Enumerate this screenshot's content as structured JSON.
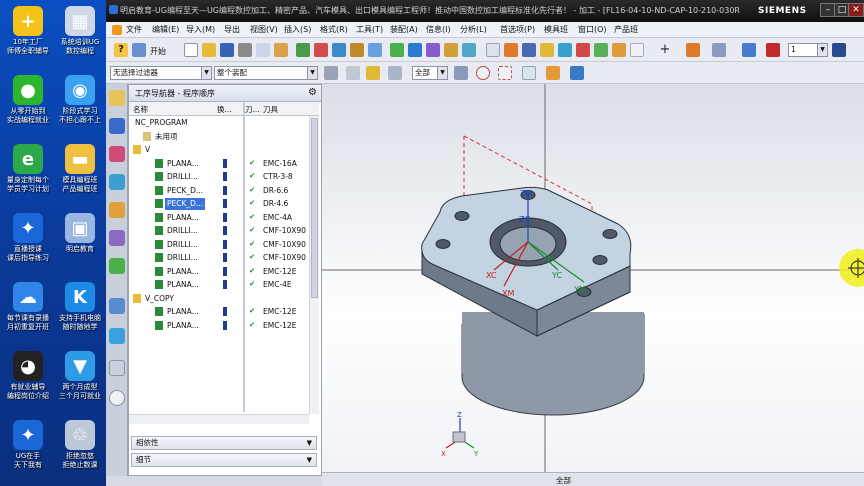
{
  "desktop": {
    "icons": [
      {
        "label1": "10年工厂",
        "label2": "师傅全职辅导",
        "icon": "plus-icon",
        "color": "#f4c21a",
        "glyph": "+"
      },
      {
        "label1": "系统培训UG",
        "label2": "数控编程",
        "icon": "calculator-icon",
        "color": "#cfd8e8",
        "glyph": "▦"
      },
      {
        "label1": "从零开始到",
        "label2": "实战编程就业",
        "icon": "wechat-icon",
        "color": "#2db52d",
        "glyph": "●"
      },
      {
        "label1": "阶段式学习",
        "label2": "不担心跟不上",
        "icon": "globe-icon",
        "color": "#3aa0f0",
        "glyph": "◉"
      },
      {
        "label1": "量身定制每个",
        "label2": "学员学习计划",
        "icon": "ie-icon",
        "color": "#2aa84a",
        "glyph": "e"
      },
      {
        "label1": "模具编程班",
        "label2": "产品编程班",
        "icon": "folder-icon",
        "color": "#f0c040",
        "glyph": "▬"
      },
      {
        "label1": "直播授课",
        "label2": "课后指导练习",
        "icon": "ug-icon",
        "color": "#1a67d8",
        "glyph": "✦"
      },
      {
        "label1": "明启教育",
        "label2": "",
        "icon": "computer-icon",
        "color": "#9ab6e0",
        "glyph": "▣"
      },
      {
        "label1": "每节课有录播",
        "label2": "月初重复开班",
        "icon": "cloud-icon",
        "color": "#2f86e8",
        "glyph": "☁"
      },
      {
        "label1": "支持手机电脑",
        "label2": "随时随地学",
        "icon": "k-icon",
        "color": "#1c8be8",
        "glyph": "K"
      },
      {
        "label1": "有就业辅导",
        "label2": "编程岗位介绍",
        "icon": "qq-icon",
        "color": "#222222",
        "glyph": "◕"
      },
      {
        "label1": "两个月成型",
        "label2": "三个月可就业",
        "icon": "download-icon",
        "color": "#2f9ae8",
        "glyph": "▼"
      },
      {
        "label1": "UG在手",
        "label2": "天下我有",
        "icon": "ug-icon",
        "color": "#1a67d8",
        "glyph": "✦"
      },
      {
        "label1": "拒绝忽悠",
        "label2": "拒绝止数课",
        "icon": "recycle-bin-icon",
        "color": "#bcc8d8",
        "glyph": "♲"
      }
    ]
  },
  "window": {
    "title": "明启教育-UG编程至天—UG编程数控加工、精密产品、汽车模具、出口模具编程工程师！推动中国数控加工编程标准化先行者！ - 加工 - [FL16-04-10-ND-CAP-10-210-030R-...",
    "brand": "SIEMENS",
    "btn_min": "–",
    "btn_max": "□",
    "btn_close": "✕"
  },
  "menubar": {
    "items": [
      "文件",
      "编辑(E)",
      "视图(V)",
      "插入(S)",
      "格式(R)",
      "工具(T)",
      "装配(A)",
      "信息(I)",
      "分析(L)",
      "首选项(P)",
      "模具班",
      "窗口(O)",
      "产品班"
    ],
    "extra": [
      "导入(M)",
      "导出"
    ],
    "start_label": "开始"
  },
  "toolbar": {
    "filter": "无选择过滤器",
    "scope": "整个装配",
    "all": "全部",
    "count": "1"
  },
  "navigator": {
    "title": "工序导航器 - 程序顺序",
    "columns": {
      "name": "名称",
      "change": "换...",
      "toolpath": "刀...",
      "tool": "刀具"
    },
    "rows": [
      {
        "name": "NC_PROGRAM",
        "indent": 0,
        "kind": "root",
        "check": "",
        "tool": ""
      },
      {
        "name": "未用项",
        "indent": 1,
        "kind": "folder",
        "check": "",
        "tool": ""
      },
      {
        "name": "V",
        "indent": 0,
        "kind": "program",
        "check": "",
        "tool": ""
      },
      {
        "name": "PLANA...",
        "indent": 2,
        "kind": "op",
        "check": "✔",
        "tool": "EMC-16A"
      },
      {
        "name": "DRILLI...",
        "indent": 2,
        "kind": "op",
        "check": "✔",
        "tool": "CTR-3-8"
      },
      {
        "name": "PECK_D...",
        "indent": 2,
        "kind": "op",
        "check": "✔",
        "tool": "DR-6.6"
      },
      {
        "name": "PECK_D...",
        "indent": 2,
        "kind": "op-selected",
        "check": "✔",
        "tool": "DR-4.6"
      },
      {
        "name": "PLANA...",
        "indent": 2,
        "kind": "op",
        "check": "✔",
        "tool": "EMC-4A"
      },
      {
        "name": "DRILLI...",
        "indent": 2,
        "kind": "op",
        "check": "✔",
        "tool": "CMF-10X90"
      },
      {
        "name": "DRILLI...",
        "indent": 2,
        "kind": "op",
        "check": "✔",
        "tool": "CMF-10X90"
      },
      {
        "name": "DRILLI...",
        "indent": 2,
        "kind": "op",
        "check": "✔",
        "tool": "CMF-10X90"
      },
      {
        "name": "PLANA...",
        "indent": 2,
        "kind": "op",
        "check": "✔",
        "tool": "EMC-12E"
      },
      {
        "name": "PLANA...",
        "indent": 2,
        "kind": "op",
        "check": "✔",
        "tool": "EMC-4E"
      },
      {
        "name": "V_COPY",
        "indent": 0,
        "kind": "program",
        "check": "",
        "tool": ""
      },
      {
        "name": "PLANA...",
        "indent": 2,
        "kind": "op",
        "check": "✔",
        "tool": "EMC-12E"
      },
      {
        "name": "PLANA...",
        "indent": 2,
        "kind": "op",
        "check": "✔",
        "tool": "EMC-12E"
      }
    ],
    "panel_dependency": "相依性",
    "panel_details": "细节"
  },
  "viewport": {
    "axes": {
      "zm": "ZM",
      "zc": "ZC",
      "xm": "XM",
      "xc": "XC",
      "yc": "YC",
      "ym": "YM"
    },
    "triad": {
      "z": "Z",
      "x": "X",
      "y": "Y"
    }
  },
  "status": {
    "selection": "全部"
  }
}
